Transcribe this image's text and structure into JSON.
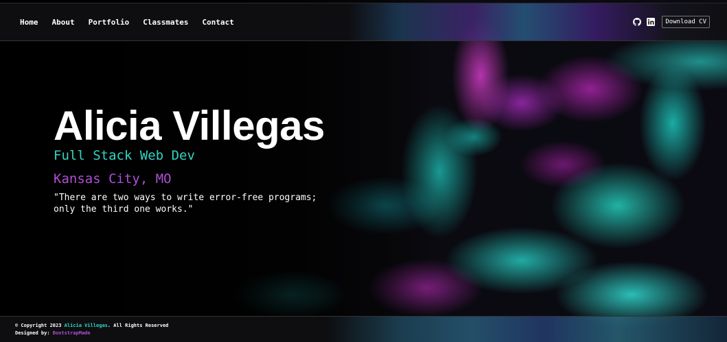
{
  "nav": {
    "links": [
      "Home",
      "About",
      "Portfolio",
      "Classmates",
      "Contact"
    ],
    "icons": [
      "github-icon",
      "linkedin-icon"
    ],
    "cv_button": "Download CV"
  },
  "hero": {
    "name": "Alicia Villegas",
    "role": "Full Stack Web Dev",
    "location": "Kansas City, MO",
    "quote_line1": "\"There are two ways to write error-free programs;",
    "quote_line2": "only the third one works.\""
  },
  "footer": {
    "copyright_prefix": "© Copyright 2023",
    "copyright_name": "Alicia Villegas",
    "copyright_suffix": ". All Rights Reserved",
    "designed_label": "Designed by:",
    "designed_by": "BootstrapMade"
  },
  "colors": {
    "accent_teal": "#34d4c3",
    "accent_purple": "#b04fd6",
    "background": "#000000"
  }
}
